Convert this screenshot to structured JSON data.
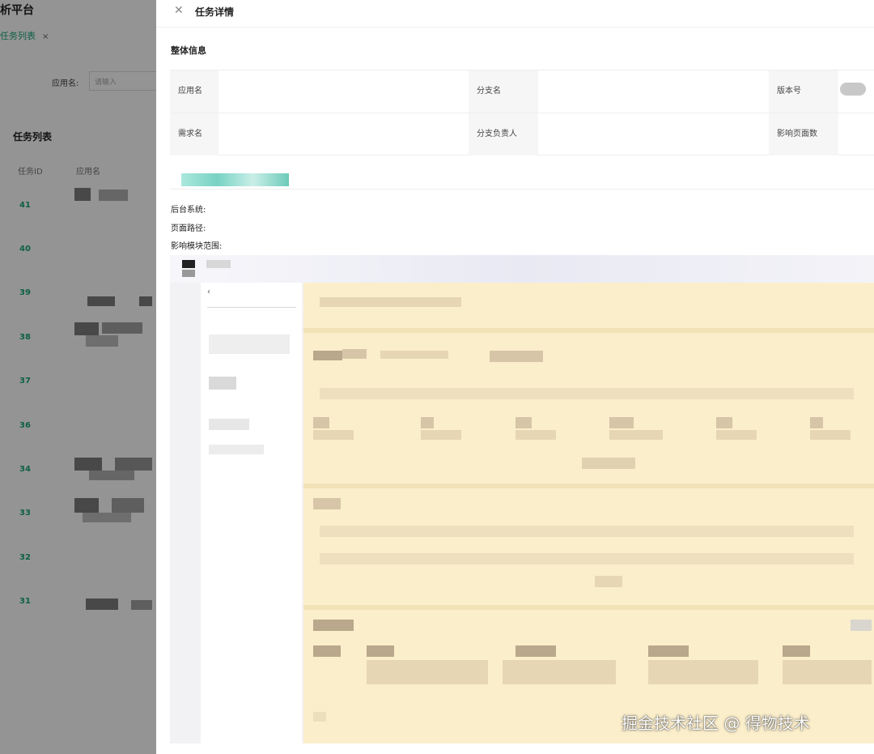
{
  "background": {
    "platform_title": "析平台",
    "active_tab": "任务列表",
    "tab_close": "×",
    "filter_label": "应用名:",
    "filter_placeholder": "请输入",
    "list_title": "任务列表",
    "columns": [
      "任务ID",
      "应用名"
    ],
    "task_ids": [
      "41",
      "40",
      "39",
      "38",
      "37",
      "36",
      "34",
      "33",
      "32",
      "31"
    ]
  },
  "drawer": {
    "close_icon": "✕",
    "title": "任务详情",
    "section_title": "整体信息",
    "info": {
      "app_name_label": "应用名",
      "branch_label": "分支名",
      "version_label": "版本号",
      "requirement_label": "需求名",
      "branch_owner_label": "分支负责人",
      "affected_pages_label": "影响页面数"
    },
    "fields": {
      "backend_label": "后台系统:",
      "page_path_label": "页面路径:",
      "module_scope_label": "影响模块范围:"
    }
  },
  "preview": {
    "chevron": "‹"
  },
  "watermark": "掘金技术社区 @ 得物技术",
  "colors": {
    "accent": "#1aa57a",
    "overlay": "rgba(0,0,0,0.42)",
    "preview_bg": "#fbeecb"
  }
}
